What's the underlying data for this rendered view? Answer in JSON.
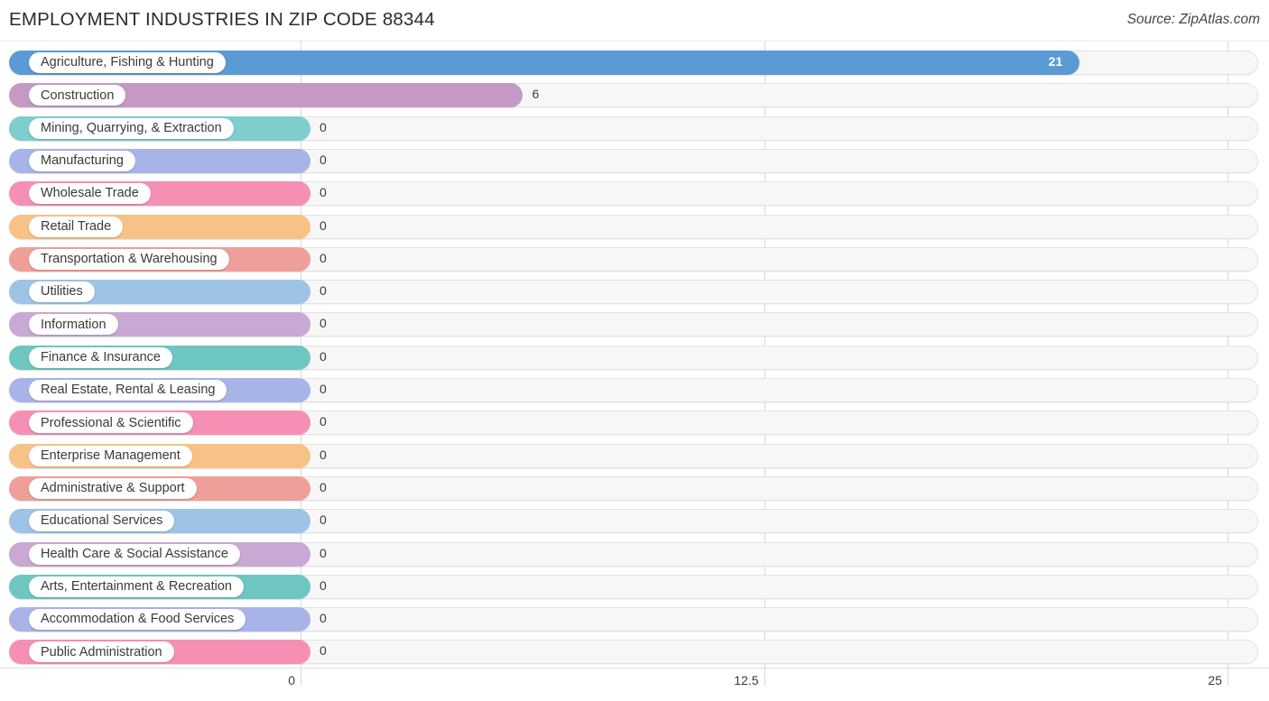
{
  "header": {
    "title": "EMPLOYMENT INDUSTRIES IN ZIP CODE 88344",
    "source": "Source: ZipAtlas.com"
  },
  "axis": {
    "ticks": [
      "0",
      "12.5",
      "25"
    ],
    "tick_values": [
      0,
      12.5,
      25
    ]
  },
  "chart_data": {
    "type": "bar",
    "orientation": "horizontal",
    "title": "EMPLOYMENT INDUSTRIES IN ZIP CODE 88344",
    "subtitle": "",
    "source": "Source: ZipAtlas.com",
    "xlabel": "",
    "ylabel": "",
    "xlim": [
      0,
      25
    ],
    "xticks": [
      0,
      12.5,
      25
    ],
    "xtick_labels": [
      "0",
      "12.5",
      "25"
    ],
    "grid": true,
    "legend": "none",
    "categories": [
      "Agriculture, Fishing & Hunting",
      "Construction",
      "Mining, Quarrying, & Extraction",
      "Manufacturing",
      "Wholesale Trade",
      "Retail Trade",
      "Transportation & Warehousing",
      "Utilities",
      "Information",
      "Finance & Insurance",
      "Real Estate, Rental & Leasing",
      "Professional & Scientific",
      "Enterprise Management",
      "Administrative & Support",
      "Educational Services",
      "Health Care & Social Assistance",
      "Arts, Entertainment & Recreation",
      "Accommodation & Food Services",
      "Public Administration"
    ],
    "values": [
      21,
      6,
      0,
      0,
      0,
      0,
      0,
      0,
      0,
      0,
      0,
      0,
      0,
      0,
      0,
      0,
      0,
      0,
      0
    ],
    "value_labels": [
      "21",
      "6",
      "0",
      "0",
      "0",
      "0",
      "0",
      "0",
      "0",
      "0",
      "0",
      "0",
      "0",
      "0",
      "0",
      "0",
      "0",
      "0",
      "0"
    ],
    "colors": [
      "#5b9bd5",
      "#c49ac4",
      "#7fcdcd",
      "#a8b4e8",
      "#f590b4",
      "#f8c287",
      "#ef9f9a",
      "#9dc3e6",
      "#c9a8d4",
      "#6ec6c0",
      "#a8b4e8",
      "#f590b4",
      "#f8c287",
      "#ef9f9a",
      "#9dc3e6",
      "#c9a8d4",
      "#6ec6c0",
      "#a8b4e8",
      "#f590b4"
    ]
  }
}
